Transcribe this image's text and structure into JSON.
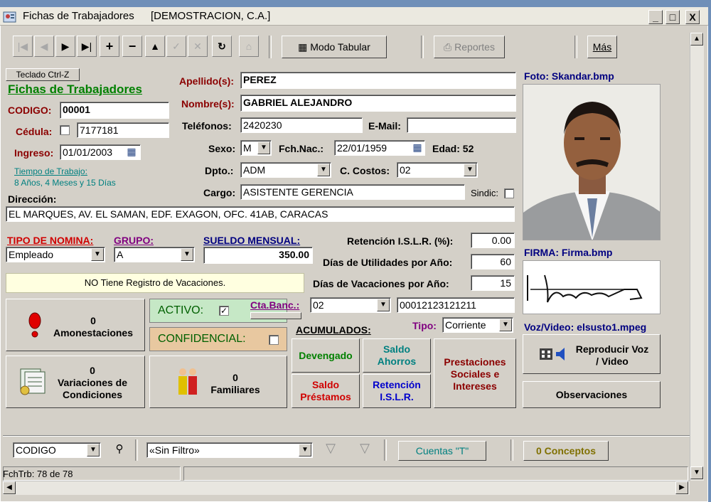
{
  "window": {
    "title": "Fichas de Trabajadores",
    "company": "[DEMOSTRACION, C.A.]",
    "minimize": "_",
    "maximize": "□",
    "close": "X"
  },
  "toolbar": {
    "modo_tabular": "Modo Tabular",
    "reportes": "Reportes",
    "mas": "Más"
  },
  "form": {
    "teclado": "Teclado Ctrl-Z",
    "heading": "Fichas de Trabajadores",
    "codigo_label": "CODIGO:",
    "codigo": "00001",
    "cedula_label": "Cédula:",
    "cedula": "7177181",
    "ingreso_label": "Ingreso:",
    "ingreso": "01/01/2003",
    "tiempo_label": "Tiempo de Trabajo:",
    "tiempo_value": "8 Años, 4 Meses y 15 Días",
    "apellido_label": "Apellido(s):",
    "apellido": "PEREZ",
    "nombre_label": "Nombre(s):",
    "nombre": "GABRIEL ALEJANDRO",
    "telefonos_label": "Teléfonos:",
    "telefonos": "2420230",
    "email_label": "E-Mail:",
    "email": "",
    "sexo_label": "Sexo:",
    "sexo": "M",
    "fchnac_label": "Fch.Nac.:",
    "fchnac": "22/01/1959",
    "edad": "Edad: 52",
    "dpto_label": "Dpto.:",
    "dpto": "ADM",
    "ccostos_label": "C. Costos:",
    "ccostos": "02",
    "cargo_label": "Cargo:",
    "cargo": "ASISTENTE GERENCIA",
    "sindic_label": "Sindic:",
    "direccion_label": "Dirección:",
    "direccion": "EL MARQUES, AV. EL SAMAN, EDF. EXAGON, OFC. 41AB, CARACAS",
    "tipo_nomina_label": "TIPO DE NOMINA:",
    "tipo_nomina": "Empleado",
    "grupo_label": "GRUPO:",
    "grupo": "A",
    "sueldo_label": "SUELDO MENSUAL:",
    "sueldo": "350.00",
    "retencion_label": "Retención I.S.L.R. (%):",
    "retencion": "0.00",
    "utilidades_label": "Días de Utilidades por Año:",
    "utilidades": "60",
    "vacaciones_label": "Días de Vacaciones por Año:",
    "vacaciones": "15",
    "vac_msg": "NO Tiene Registro de Vacaciones.",
    "ctabanc_label": "Cta.Banc.:",
    "banco": "02",
    "cuenta": "00012123121211",
    "tipo_label": "Tipo:",
    "tipo": "Corriente",
    "activo": "ACTIVO:",
    "confidencial": "CONFIDENCIAL:",
    "acumulados": "ACUMULADOS:",
    "devengado": "Devengado",
    "saldo_ahorros": "Saldo Ahorros",
    "saldo_prestamos": "Saldo Préstamos",
    "retencion_islr": "Retención I.S.L.R.",
    "prestaciones": "Prestaciones Sociales e Intereses",
    "amonestaciones_count": "0",
    "amonestaciones": "Amonestaciones",
    "variaciones_count": "0",
    "variaciones": "Variaciones de Condiciones",
    "familiares_count": "0",
    "familiares": "Familiares"
  },
  "media": {
    "foto_label": "Foto: Skandar.bmp",
    "firma_label": "FIRMA: Firma.bmp",
    "voz_label": "Voz/Video: elsusto1.mpeg",
    "reproducir": "Reproducir Voz / Video",
    "observaciones": "Observaciones"
  },
  "bottom": {
    "orden": "CODIGO",
    "filtro": "«Sin Filtro»",
    "cuentas": "Cuentas \"T\"",
    "conceptos": "0  Conceptos",
    "status": "FchTrb:  78 de 78"
  },
  "colors": {
    "accent_green": "#008000",
    "dark_red": "#8b0000",
    "blue": "#0000cc",
    "activo_bg": "#c6e8c6",
    "confidencial_bg": "#e8c8a0",
    "vac_bg": "#ffffe0"
  }
}
